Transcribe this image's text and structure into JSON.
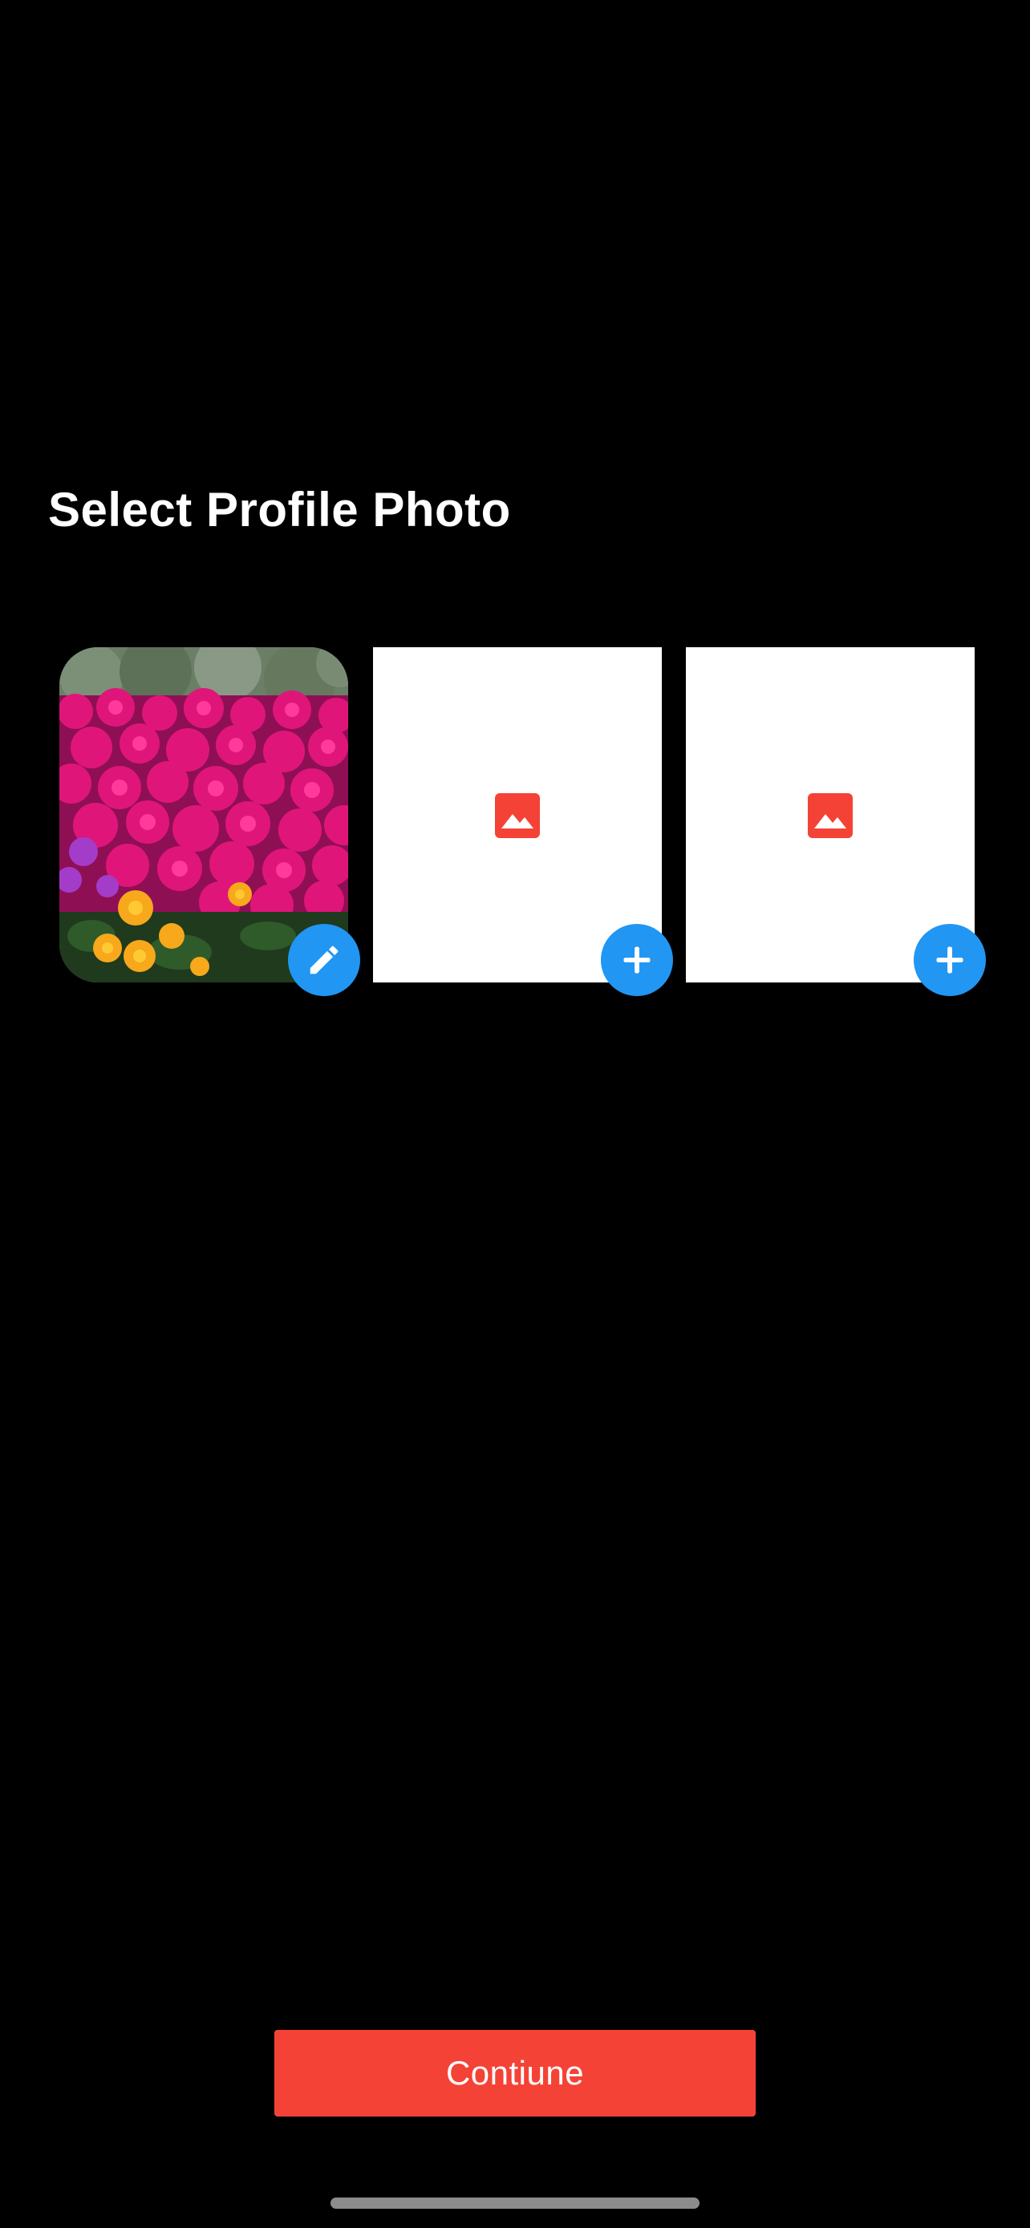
{
  "screen": {
    "title": "Select Profile Photo"
  },
  "photo_slots": [
    {
      "state": "filled",
      "content": "flower-photo",
      "action_icon": "pencil-icon"
    },
    {
      "state": "empty",
      "content": "image-placeholder-icon",
      "action_icon": "plus-icon"
    },
    {
      "state": "empty",
      "content": "image-placeholder-icon",
      "action_icon": "plus-icon"
    }
  ],
  "continue_button": {
    "label": "Contiune"
  },
  "colors": {
    "background": "#000000",
    "accent_blue": "#2196f3",
    "primary_red": "#f44336",
    "slot_background": "#ffffff"
  }
}
